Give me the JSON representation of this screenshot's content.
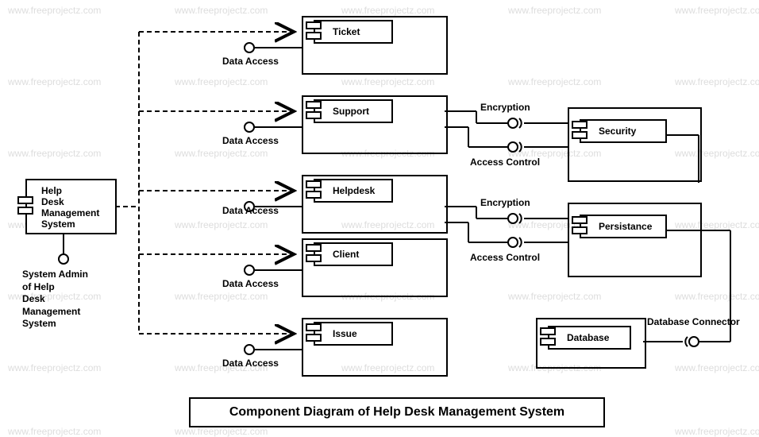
{
  "watermark_text": "www.freeprojectz.com",
  "title": "Component Diagram of Help Desk Management System",
  "main_component": {
    "name": "Help Desk Management System",
    "lines": [
      "Help",
      "Desk",
      "Management",
      "System"
    ]
  },
  "admin_label": {
    "lines": [
      "System Admin",
      "of Help",
      "Desk",
      "Management",
      "System"
    ]
  },
  "middle_components": [
    {
      "label": "Ticket"
    },
    {
      "label": "Support"
    },
    {
      "label": "Helpdesk"
    },
    {
      "label": "Client"
    },
    {
      "label": "Issue"
    }
  ],
  "data_access_label": "Data Access",
  "right_components": [
    {
      "label": "Security"
    },
    {
      "label": "Persistance"
    },
    {
      "label": "Database"
    }
  ],
  "interface_labels": {
    "encryption": "Encryption",
    "access_control": "Access Control",
    "database_connector": "Database Connector"
  }
}
